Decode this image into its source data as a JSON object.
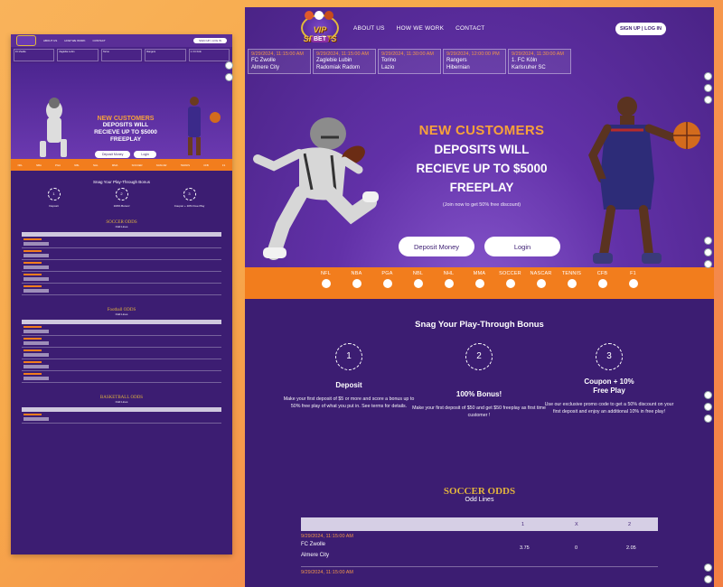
{
  "site": {
    "logo_text": "VIP SPORTS",
    "logo_sub": "BET",
    "nav": [
      "ABOUT US",
      "HOW WE WORK",
      "CONTACT"
    ],
    "signup": "SIGN UP | LOG IN"
  },
  "ticker": [
    {
      "date": "9/29/2024, 11:15:00 AM",
      "team1": "FC Zwolle",
      "team2": "Almere City"
    },
    {
      "date": "9/29/2024, 11:15:00 AM",
      "team1": "Zaglebie Lubin",
      "team2": "Radomiak Radom"
    },
    {
      "date": "9/29/2024, 11:30:00 AM",
      "team1": "Torino",
      "team2": "Lazio"
    },
    {
      "date": "9/29/2024, 12:00:00 PM",
      "team1": "Rangers",
      "team2": "Hibernian"
    },
    {
      "date": "9/29/2024, 11:30:00 AM",
      "team1": "1. FC Köln",
      "team2": "Karlsruher SC"
    }
  ],
  "hero": {
    "kicker": "NEW CUSTOMERS",
    "line1": "DEPOSITS WILL",
    "line2": "RECIEVE UP TO $5000",
    "line3": "FREEPLAY",
    "sub": "(Join now to get 50% free discount)",
    "deposit_btn": "Deposit Money",
    "login_btn": "Login"
  },
  "sports": [
    "NFL",
    "NBA",
    "PGA",
    "NBL",
    "NHL",
    "MMA",
    "SOCCER",
    "NASCAR",
    "TENNIS",
    "CFB",
    "F1"
  ],
  "bonus": {
    "title": "Snag Your Play-Through Bonus",
    "steps": [
      {
        "num": "1",
        "title": "Deposit",
        "text": "Make your first deposit of $5 or more and score a bonus up to 50% free play of what you put in. See terms for details."
      },
      {
        "num": "2",
        "title": "100% Bonus!",
        "text": "Make your first deposit of $50 and get $50 freeplay as first time customer !"
      },
      {
        "num": "3",
        "title": "Coupon + 10% Free Play",
        "text": "Use our exclusive promo code to get a 50% discount on your first deposit and enjoy an additional 10% in free play!"
      }
    ]
  },
  "soccer_odds": {
    "title": "SOCCER ODDS",
    "sub": "Odd Lines",
    "headers": [
      "1",
      "X",
      "2"
    ],
    "rows": [
      {
        "date": "9/29/2024, 11:15:00 AM",
        "team1": "FC Zwolle",
        "team2": "Almere City",
        "one": "3.75",
        "x": "0",
        "two": "2.05"
      },
      {
        "date": "9/29/2024, 11:15:00 AM",
        "team1": "",
        "team2": "",
        "one": "",
        "x": "",
        "two": ""
      }
    ]
  },
  "thumbnail": {
    "football_title": "Football ODDS",
    "basketball_title": "BASKETBALL ODDS"
  },
  "colors": {
    "purple": "#3c1d72",
    "orange": "#f27d1d",
    "gold": "#e4b63c"
  }
}
